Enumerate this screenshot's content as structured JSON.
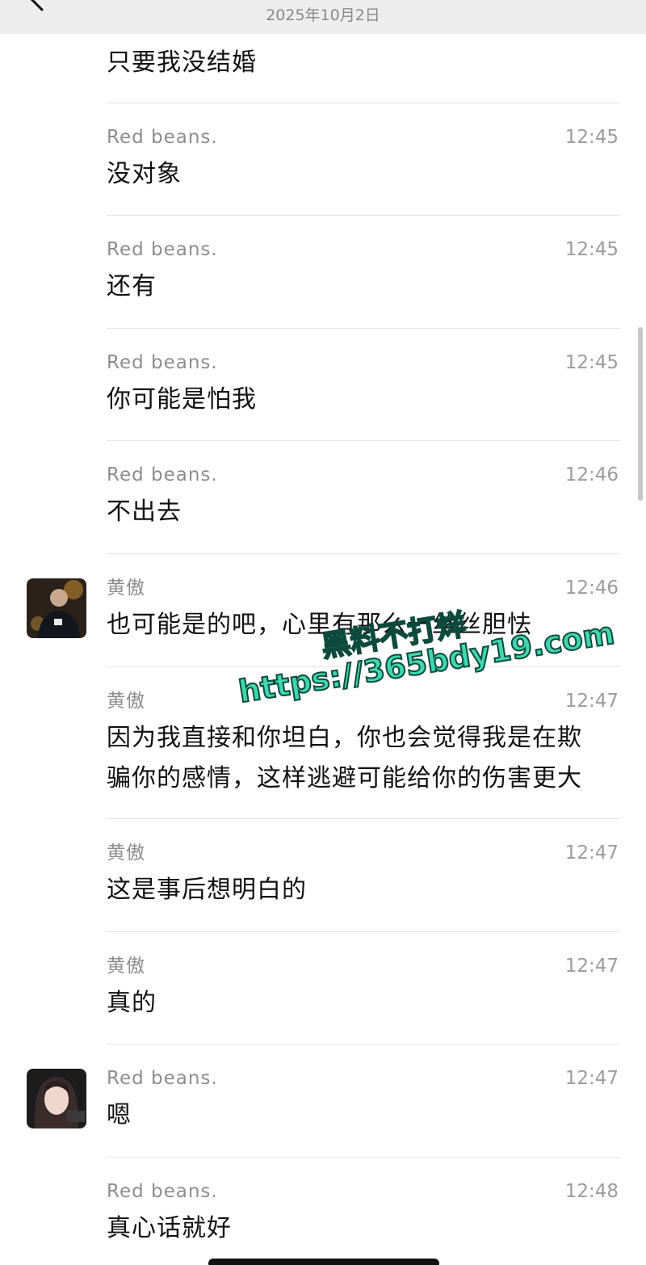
{
  "header": {
    "date": "2025年10月2日"
  },
  "messages": [
    {
      "sender": "",
      "time": "",
      "lines": [
        "只要我没结婚"
      ]
    },
    {
      "sender": "Red  beans.",
      "time": "12:45",
      "lines": [
        "没对象"
      ]
    },
    {
      "sender": "Red  beans.",
      "time": "12:45",
      "lines": [
        "还有"
      ]
    },
    {
      "sender": "Red  beans.",
      "time": "12:45",
      "lines": [
        "你可能是怕我"
      ]
    },
    {
      "sender": "Red  beans.",
      "time": "12:46",
      "lines": [
        "不出去"
      ]
    },
    {
      "sender": "黄傲",
      "time": "12:46",
      "lines": [
        "也可能是的吧，心里有那么一丝丝胆怯"
      ]
    },
    {
      "sender": "黄傲",
      "time": "12:47",
      "lines": [
        "因为我直接和你坦白，你也会觉得我是在欺",
        "骗你的感情，这样逃避可能给你的伤害更大"
      ]
    },
    {
      "sender": "黄傲",
      "time": "12:47",
      "lines": [
        "这是事后想明白的"
      ]
    },
    {
      "sender": "黄傲",
      "time": "12:47",
      "lines": [
        "真的"
      ]
    },
    {
      "sender": "Red  beans.",
      "time": "12:47",
      "lines": [
        "嗯"
      ]
    },
    {
      "sender": "Red  beans.",
      "time": "12:48",
      "lines": [
        "真心话就好"
      ]
    }
  ],
  "watermark": {
    "line1": "黑料不打烊",
    "line2": "https://365bdy19.com"
  },
  "colors": {
    "header_bg": "#ededed",
    "sender_text": "#8d8d8d",
    "message_text": "#111111",
    "watermark": "#3fd6b0"
  }
}
